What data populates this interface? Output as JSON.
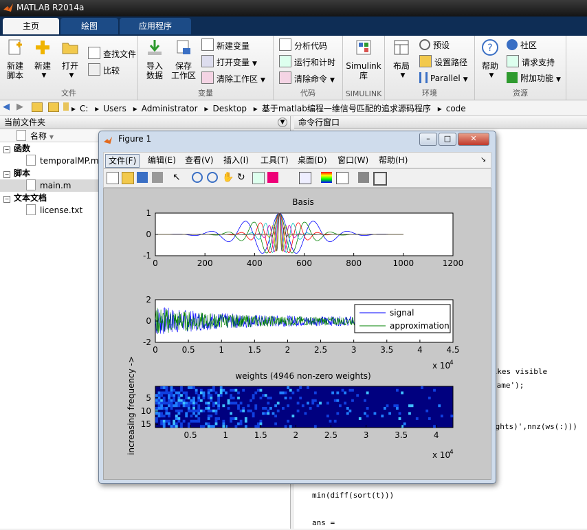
{
  "app": {
    "title": "MATLAB R2014a"
  },
  "ribbon_tabs": [
    "主页",
    "绘图",
    "应用程序"
  ],
  "ribbon": {
    "file_group": {
      "label": "文件",
      "new_script": [
        "新建",
        "脚本"
      ],
      "new": "新建",
      "open": "打开",
      "find_files": "查找文件",
      "compare": "比较"
    },
    "variable_group": {
      "label": "变量",
      "import": [
        "导入",
        "数据"
      ],
      "save_ws": [
        "保存",
        "工作区"
      ],
      "new_var": "新建变量",
      "open_var": "打开变量",
      "clear_ws": "清除工作区"
    },
    "code_group": {
      "label": "代码",
      "analyze": "分析代码",
      "run_time": "运行和计时",
      "clear_cmd": "清除命令"
    },
    "simulink_group": {
      "label": "SIMULINK",
      "simulink": [
        "Simulink",
        "库"
      ]
    },
    "env_group": {
      "label": "环境",
      "layout": "布局",
      "prefs": "预设",
      "set_path": "设置路径",
      "parallel": "Parallel"
    },
    "resources_group": {
      "label": "资源",
      "help": "帮助",
      "community": "社区",
      "support": "请求支持",
      "addons": "附加功能"
    }
  },
  "address": [
    "C:",
    "Users",
    "Administrator",
    "Desktop",
    "基于matlab编程一维信号匹配的追求源码程序",
    "code"
  ],
  "current_folder": {
    "title": "当前文件夹",
    "column": "名称",
    "sections": [
      {
        "name": "函数",
        "files": [
          "temporalMP.m"
        ]
      },
      {
        "name": "脚本",
        "files": [
          "main.m"
        ]
      },
      {
        "name": "文本文档",
        "files": [
          "license.txt"
        ]
      }
    ]
  },
  "command_window": {
    "title": "命令行窗口",
    "lines": [
      "pikes visible",
      "same');",
      "ights)',nnz(ws(:)))",
      "min(diff(sort(t)))",
      "ans ="
    ]
  },
  "figure": {
    "title": "Figure 1",
    "menu": [
      "文件(F)",
      "编辑(E)",
      "查看(V)",
      "插入(I)",
      "工具(T)",
      "桌面(D)",
      "窗口(W)",
      "帮助(H)"
    ]
  },
  "chart_data": [
    {
      "type": "line",
      "title": "Basis",
      "xlim": [
        0,
        1200
      ],
      "ylim": [
        -1,
        1
      ],
      "xticks": [
        "0",
        "200",
        "400",
        "600",
        "800",
        "1000",
        "1200"
      ],
      "yticks": [
        "1",
        "0",
        "-1"
      ],
      "series_colors": [
        "#0000ff",
        "#008000",
        "#ff0000",
        "#00bfbf",
        "#bf00bf",
        "#bfbf00",
        "#404040"
      ]
    },
    {
      "type": "line",
      "title": "",
      "xlim": [
        0,
        45000
      ],
      "ylim": [
        -2,
        2
      ],
      "xticks": [
        "0",
        "0.5",
        "1",
        "1.5",
        "2",
        "2.5",
        "3",
        "3.5",
        "4",
        "4.5"
      ],
      "yticks": [
        "2",
        "0",
        "-2"
      ],
      "x_multiplier": "x 10",
      "x_exponent": "4",
      "series": [
        {
          "name": "signal",
          "color": "#0000ff"
        },
        {
          "name": "approximation",
          "color": "#008000"
        }
      ],
      "legend": "top-right"
    },
    {
      "type": "heatmap",
      "title": "weights (4946 non-zero weights)",
      "ylabel": "increasing frequency ->",
      "xticks": [
        "0.5",
        "1",
        "1.5",
        "2",
        "2.5",
        "3",
        "3.5",
        "4"
      ],
      "yticks": [
        "5",
        "10",
        "15"
      ],
      "x_multiplier": "x 10",
      "x_exponent": "4"
    }
  ]
}
